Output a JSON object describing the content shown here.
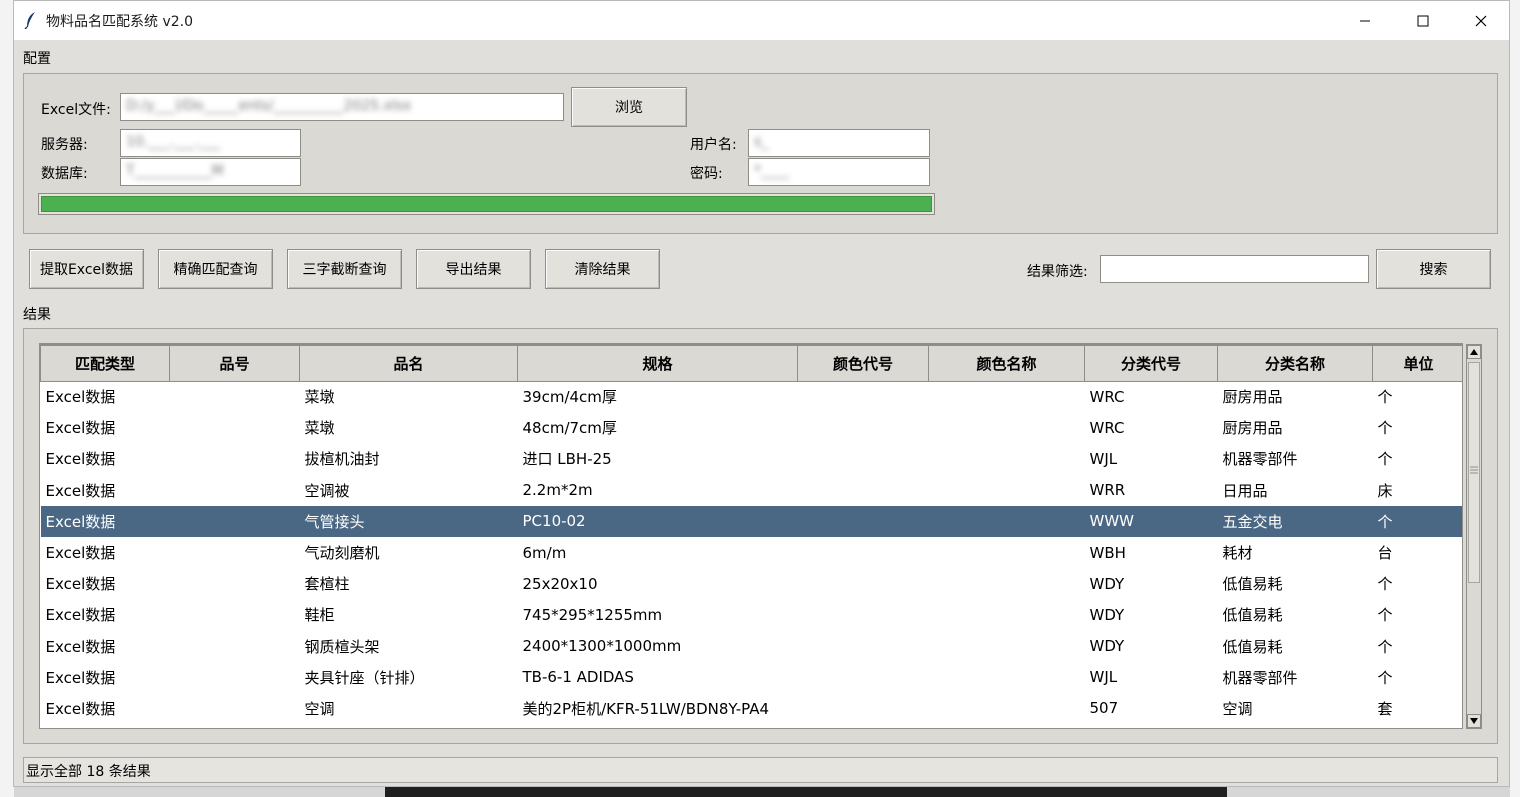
{
  "window": {
    "title": "物料品名匹配系统 v2.0"
  },
  "config": {
    "section_label": "配置",
    "excel_label": "Excel文件:",
    "excel_value": "D:/y___l/Do_____ents/__________2025.xlsx",
    "browse_label": "浏览",
    "server_label": "服务器:",
    "server_value": "10.___.___.___",
    "database_label": "数据库:",
    "database_value": "T___________M",
    "user_label": "用户名:",
    "user_value": "s_",
    "password_label": "密码:",
    "password_value": "*____",
    "progress": 1.0
  },
  "toolbar": {
    "extract_label": "提取Excel数据",
    "exact_label": "精确匹配查询",
    "three_char_label": "三字截断查询",
    "export_label": "导出结果",
    "clear_label": "清除结果",
    "filter_label": "结果筛选:",
    "filter_value": "",
    "search_label": "搜索"
  },
  "results": {
    "section_label": "结果",
    "columns": [
      "匹配类型",
      "品号",
      "品名",
      "规格",
      "颜色代号",
      "颜色名称",
      "分类代号",
      "分类名称",
      "单位"
    ],
    "rows": [
      [
        "Excel数据",
        "",
        "菜墩",
        "39cm/4cm厚",
        "",
        "",
        "WRC",
        "厨房用品",
        "个"
      ],
      [
        "Excel数据",
        "",
        "菜墩",
        "48cm/7cm厚",
        "",
        "",
        "WRC",
        "厨房用品",
        "个"
      ],
      [
        "Excel数据",
        "",
        "拔楦机油封",
        "进口 LBH-25",
        "",
        "",
        "WJL",
        "机器零部件",
        "个"
      ],
      [
        "Excel数据",
        "",
        "空调被",
        "2.2m*2m",
        "",
        "",
        "WRR",
        "日用品",
        "床"
      ],
      [
        "Excel数据",
        "",
        "气管接头",
        "PC10-02",
        "",
        "",
        "WWW",
        "五金交电",
        "个"
      ],
      [
        "Excel数据",
        "",
        "气动刻磨机",
        "6m/m",
        "",
        "",
        "WBH",
        "耗材",
        "台"
      ],
      [
        "Excel数据",
        "",
        "套楦柱",
        "25x20x10",
        "",
        "",
        "WDY",
        "低值易耗",
        "个"
      ],
      [
        "Excel数据",
        "",
        "鞋柜",
        "745*295*1255mm",
        "",
        "",
        "WDY",
        "低值易耗",
        "个"
      ],
      [
        "Excel数据",
        "",
        "钢质楦头架",
        "2400*1300*1000mm",
        "",
        "",
        "WDY",
        "低值易耗",
        "个"
      ],
      [
        "Excel数据",
        "",
        "夹具针座（针排）",
        "TB-6-1 ADIDAS",
        "",
        "",
        "WJL",
        "机器零部件",
        "个"
      ],
      [
        "Excel数据",
        "",
        "空调",
        "美的2P柜机/KFR-51LW/BDN8Y-PA4",
        "",
        "",
        "507",
        "空调",
        "套"
      ]
    ],
    "selected_row": 4
  },
  "status": {
    "text": "显示全部 18 条结果"
  },
  "colors": {
    "selection": "#4a6783",
    "progress": "#4caf50"
  }
}
